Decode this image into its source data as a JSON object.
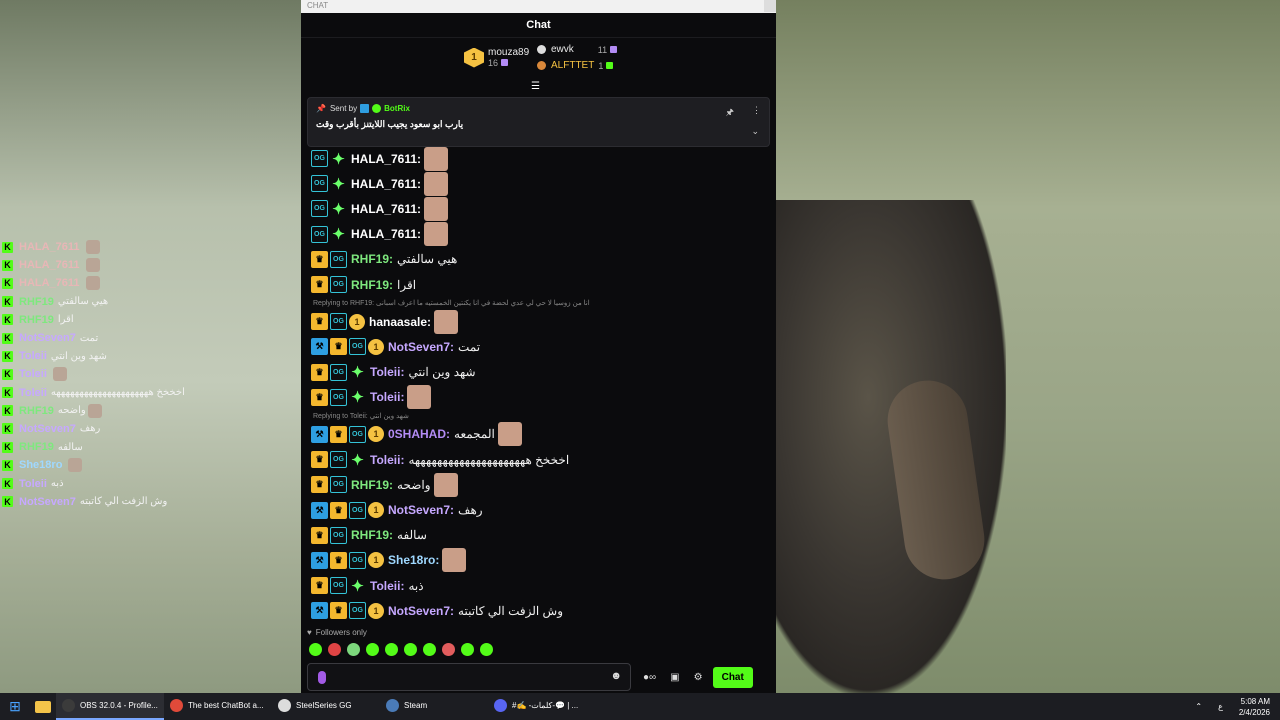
{
  "window": {
    "titlebar_label": "CHAT",
    "header_title": "Chat"
  },
  "leaderboard": {
    "first": {
      "rank": "1",
      "name": "mouza89",
      "count": "16"
    },
    "second": {
      "name": "ewvk",
      "count": "11"
    },
    "third": {
      "name": "ALFTTET",
      "count": "1"
    }
  },
  "pinned": {
    "sent_by_label": "Sent by",
    "sender": "BotRix",
    "message": "يارب ابو سعود يجيب اللايتنز بأقرب وقت"
  },
  "replies": {
    "r1": "Replying to RHF19: انا من زوسيا لا حي لي عدي لحضة في انا يكنتين الخمستيه ما اعرف اسبانى",
    "r2": "Replying to Toleii: شهد وين انتي"
  },
  "messages": [
    {
      "badges": [
        "og",
        "spark"
      ],
      "name": "HALA_7611:",
      "name_color": "#ffffff",
      "text": "",
      "emote": true
    },
    {
      "badges": [
        "og",
        "spark"
      ],
      "name": "HALA_7611:",
      "name_color": "#ffffff",
      "text": "",
      "emote": true
    },
    {
      "badges": [
        "og",
        "spark"
      ],
      "name": "HALA_7611:",
      "name_color": "#ffffff",
      "text": "",
      "emote": true
    },
    {
      "badges": [
        "og",
        "spark"
      ],
      "name": "HALA_7611:",
      "name_color": "#ffffff",
      "text": "",
      "emote": true
    },
    {
      "badges": [
        "crown",
        "og"
      ],
      "name": "RHF19:",
      "name_color": "#7ee87e",
      "text": "هيي سالفتي",
      "emote": false
    },
    {
      "badges": [
        "crown",
        "og"
      ],
      "name": "RHF19:",
      "name_color": "#7ee87e",
      "text": "اقرا",
      "emote": false
    },
    {
      "badges": [
        "crown",
        "og",
        "sub"
      ],
      "name": "hanaasale:",
      "name_color": "#ffffff",
      "text": "",
      "emote": true
    },
    {
      "badges": [
        "hammer",
        "crown",
        "og",
        "sub"
      ],
      "name": "NotSeven7:",
      "name_color": "#c6a8ff",
      "text": "تمت",
      "emote": false
    },
    {
      "badges": [
        "crown",
        "og",
        "spark"
      ],
      "name": "Toleii:",
      "name_color": "#c6a8ff",
      "text": "شهد وين انتي",
      "emote": false
    },
    {
      "badges": [
        "crown",
        "og",
        "spark"
      ],
      "name": "Toleii:",
      "name_color": "#c6a8ff",
      "text": "",
      "emote": true
    },
    {
      "badges": [
        "hammer",
        "crown",
        "og",
        "sub"
      ],
      "name": "0SHAHAD:",
      "name_color": "#b38cf5",
      "text": "المجمعه",
      "emote": true
    },
    {
      "badges": [
        "crown",
        "og",
        "spark"
      ],
      "name": "Toleii:",
      "name_color": "#c6a8ff",
      "text": "اخخخخ هههههههههههههههههههههه",
      "emote": false
    },
    {
      "badges": [
        "crown",
        "og"
      ],
      "name": "RHF19:",
      "name_color": "#7ee87e",
      "text": "واضحه",
      "emote": true
    },
    {
      "badges": [
        "hammer",
        "crown",
        "og",
        "sub"
      ],
      "name": "NotSeven7:",
      "name_color": "#c6a8ff",
      "text": "رهف",
      "emote": false
    },
    {
      "badges": [
        "crown",
        "og"
      ],
      "name": "RHF19:",
      "name_color": "#7ee87e",
      "text": "سالفه",
      "emote": false
    },
    {
      "badges": [
        "hammer",
        "crown",
        "og",
        "sub"
      ],
      "name": "She18ro:",
      "name_color": "#9fd8ff",
      "text": "",
      "emote": true
    },
    {
      "badges": [
        "crown",
        "og",
        "spark"
      ],
      "name": "Toleii:",
      "name_color": "#c6a8ff",
      "text": "ذبه",
      "emote": false
    },
    {
      "badges": [
        "hammer",
        "crown",
        "og",
        "sub"
      ],
      "name": "NotSeven7:",
      "name_color": "#c6a8ff",
      "text": "وش الزفت الي كاتبته",
      "emote": false
    }
  ],
  "overlay": [
    {
      "name": "HALA_7611",
      "color": "#e8b6b6",
      "text": "",
      "emote": true
    },
    {
      "name": "HALA_7611",
      "color": "#e8b6b6",
      "text": "",
      "emote": true
    },
    {
      "name": "HALA_7611",
      "color": "#e8b6b6",
      "text": "",
      "emote": true
    },
    {
      "name": "RHF19",
      "color": "#7ee87e",
      "text": "هيي سالفتي",
      "emote": false
    },
    {
      "name": "RHF19",
      "color": "#7ee87e",
      "text": "اقرا",
      "emote": false
    },
    {
      "name": "NotSeven7",
      "color": "#c6a8ff",
      "text": "تمت",
      "emote": false
    },
    {
      "name": "Toleii",
      "color": "#c6a8ff",
      "text": "شهد وين انتي",
      "emote": false
    },
    {
      "name": "Toleii",
      "color": "#c6a8ff",
      "text": "",
      "emote": true
    },
    {
      "name": "Toleii",
      "color": "#c6a8ff",
      "text": "اخخخخ هههههههههههههههههههههه",
      "emote": false
    },
    {
      "name": "RHF19",
      "color": "#7ee87e",
      "text": "واضحه",
      "emote": true
    },
    {
      "name": "NotSeven7",
      "color": "#c6a8ff",
      "text": "رهف",
      "emote": false
    },
    {
      "name": "RHF19",
      "color": "#7ee87e",
      "text": "سالفه",
      "emote": false
    },
    {
      "name": "She18ro",
      "color": "#9fd8ff",
      "text": "",
      "emote": true
    },
    {
      "name": "Toleii",
      "color": "#c6a8ff",
      "text": "ذبه",
      "emote": false
    },
    {
      "name": "NotSeven7",
      "color": "#c6a8ff",
      "text": "وش الزفت الي كاتبته",
      "emote": false
    }
  ],
  "footer": {
    "followers_label": "Followers only",
    "send_label": "Chat"
  },
  "taskbar": {
    "apps": [
      {
        "label": "OBS 32.0.4 - Profile...",
        "color": "#3b3b3b",
        "active": true
      },
      {
        "label": "The best ChatBot a...",
        "color": "#e04a3a",
        "active": false
      },
      {
        "label": "SteelSeries GG",
        "color": "#dcdcdc",
        "active": false
      },
      {
        "label": "Steam",
        "color": "#4a7bb8",
        "active": false
      },
      {
        "label": "#✍️ -كلمات-💬 | ...",
        "color": "#5865f2",
        "active": false
      }
    ],
    "lang": "ع",
    "time": "5:08 AM",
    "date": "2/4/2026"
  },
  "colors": {
    "kick_green": "#53fc18",
    "background": "#0b0b0d"
  }
}
